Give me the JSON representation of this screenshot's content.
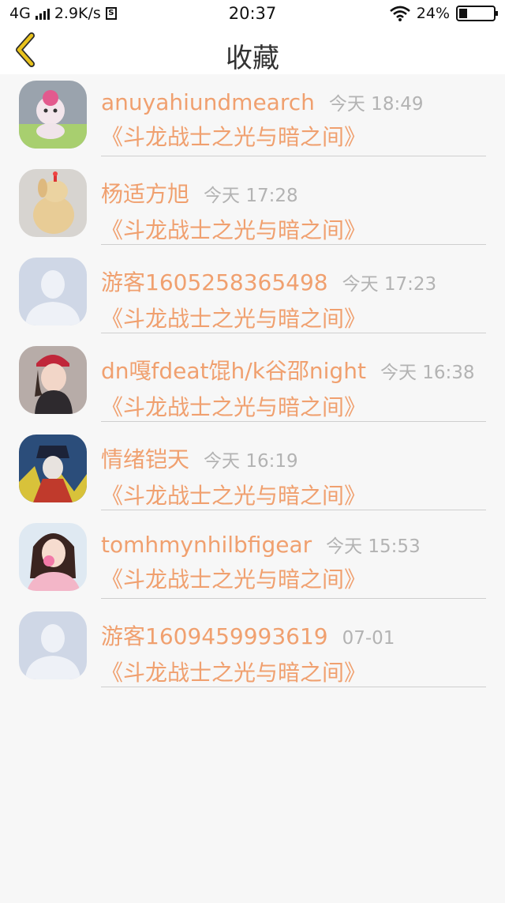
{
  "status_bar": {
    "network": "4G",
    "speed": "2.9K/s",
    "sd_label": "S",
    "time": "20:37",
    "battery": "24%"
  },
  "header": {
    "back_icon": "chevron-left-icon",
    "title": "收藏",
    "accent_color": "#e8c21c"
  },
  "colors": {
    "name": "#f0a06f",
    "time": "#b3b3b3",
    "divider": "#cfcfcf",
    "background": "#f7f7f7"
  },
  "favorites": [
    {
      "name": "anuyahiundmearch",
      "time": "今天 18:49",
      "book": "《斗龙战士之光与暗之间》",
      "avatar": "plush-toy-photo"
    },
    {
      "name": "杨适方旭",
      "time": "今天 17:28",
      "book": "《斗龙战士之光与暗之间》",
      "avatar": "dog-figurine-photo"
    },
    {
      "name": "游客1605258365498",
      "time": "今天 17:23",
      "book": "《斗龙战士之光与暗之间》",
      "avatar": "default-user-avatar"
    },
    {
      "name": "dn嘎fdeat馄h/k谷邵night",
      "time": "今天 16:38",
      "book": "《斗龙战士之光与暗之间》",
      "avatar": "girl-red-cap-photo"
    },
    {
      "name": "情绪铠天",
      "time": "今天 16:19",
      "book": "《斗龙战士之光与暗之间》",
      "avatar": "anime-illustration"
    },
    {
      "name": "tomhmynhilbfigear",
      "time": "今天 15:53",
      "book": "《斗龙战士之光与暗之间》",
      "avatar": "anime-girl-photo"
    },
    {
      "name": "游客1609459993619",
      "time": "07-01",
      "book": "《斗龙战士之光与暗之间》",
      "avatar": "default-user-avatar"
    }
  ]
}
